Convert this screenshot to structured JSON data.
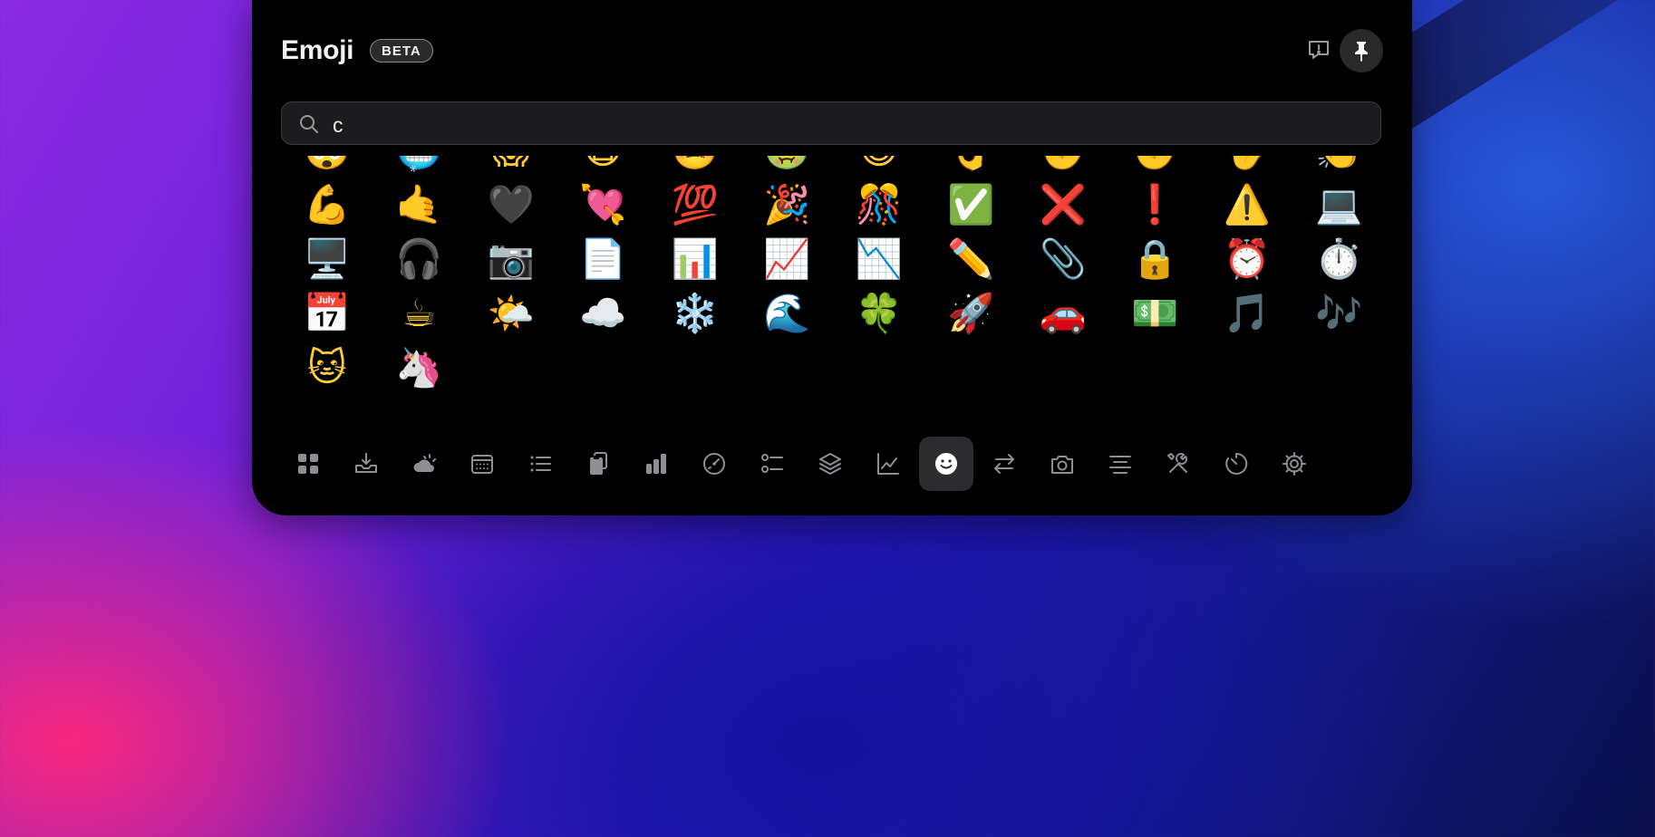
{
  "header": {
    "title": "Emoji",
    "badge": "BETA",
    "feedback_icon": "feedback-icon",
    "pin_icon": "pin-icon"
  },
  "search": {
    "value": "c",
    "placeholder": "",
    "icon": "search-icon"
  },
  "emojis": [
    "🤯",
    "🥶",
    "😱",
    "😷",
    "🤒",
    "🤢",
    "😃",
    "👌",
    "✊",
    "✊",
    "✋",
    "👏",
    "💪",
    "🤙",
    "🖤",
    "💘",
    "💯",
    "🎉",
    "🎊",
    "✅",
    "❌",
    "❗",
    "⚠️",
    "💻",
    "🖥️",
    "🎧",
    "📷",
    "📄",
    "📊",
    "📈",
    "📉",
    "✏️",
    "📎",
    "🔒",
    "⏰",
    "⏱️",
    "📅",
    "☕",
    "🌤️",
    "☁️",
    "❄️",
    "🌊",
    "🍀",
    "🚀",
    "🚗",
    "💵",
    "🎵",
    "🎶",
    "🐱",
    "🦄"
  ],
  "toolbar": [
    {
      "name": "apps-icon",
      "active": false
    },
    {
      "name": "inbox-download-icon",
      "active": false
    },
    {
      "name": "weather-icon",
      "active": false
    },
    {
      "name": "calendar-icon",
      "active": false
    },
    {
      "name": "list-icon",
      "active": false
    },
    {
      "name": "clipboard-icon",
      "active": false
    },
    {
      "name": "bar-chart-icon",
      "active": false
    },
    {
      "name": "speedometer-icon",
      "active": false
    },
    {
      "name": "checklist-icon",
      "active": false
    },
    {
      "name": "layers-icon",
      "active": false
    },
    {
      "name": "line-chart-icon",
      "active": false
    },
    {
      "name": "emoji-smile-icon",
      "active": true
    },
    {
      "name": "swap-arrows-icon",
      "active": false
    },
    {
      "name": "camera-icon",
      "active": false
    },
    {
      "name": "text-align-icon",
      "active": false
    },
    {
      "name": "tools-icon",
      "active": false
    },
    {
      "name": "timer-icon",
      "active": false
    },
    {
      "name": "gear-icon",
      "active": false
    }
  ],
  "colors": {
    "panel_bg": "#000000",
    "search_bg": "#1c1c1e",
    "active_tab_bg": "#2c2c2e",
    "text": "#f2f2f2",
    "icon": "#8e8e93"
  }
}
